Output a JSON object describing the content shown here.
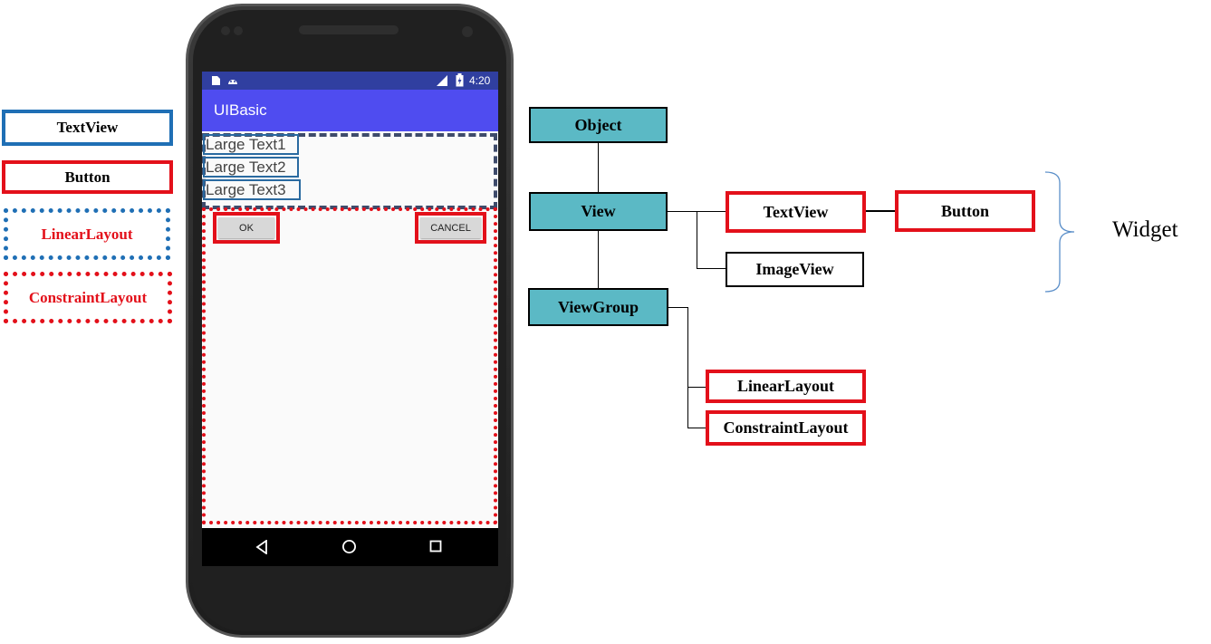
{
  "legend": {
    "textview": "TextView",
    "button": "Button",
    "linearlayout": "LinearLayout",
    "constraintlayout": "ConstraintLayout"
  },
  "phone": {
    "status_time": "4:20",
    "app_title": "UIBasic",
    "texts": [
      "Large Text1",
      "Large Text2",
      "Large Text3"
    ],
    "ok_label": "OK",
    "cancel_label": "CANCEL"
  },
  "hierarchy": {
    "object": "Object",
    "view": "View",
    "viewgroup": "ViewGroup",
    "textview": "TextView",
    "button": "Button",
    "imageview": "ImageView",
    "linearlayout": "LinearLayout",
    "constraintlayout": "ConstraintLayout",
    "widget_label": "Widget"
  },
  "colors": {
    "teal": "#5bb9c5",
    "red": "#e3101a",
    "blue": "#1f6fb5",
    "appbar": "#4f4cf0"
  }
}
